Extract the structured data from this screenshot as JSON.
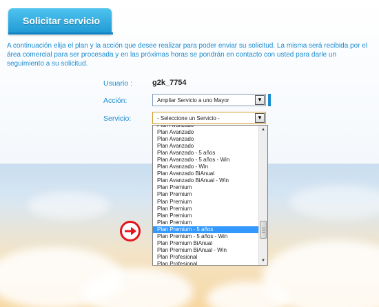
{
  "header": {
    "title": "Solicitar servicio"
  },
  "intro_text": "A continuación elija el plan y la acción que desee realizar para poder enviar su solicitud. La misma será recibida por el área comercial para ser procesada y en las próximas horas se pondrán en contacto con usted para darle un seguimiento a su solicitud.",
  "form": {
    "user_label": "Usuario :",
    "user_value": "g2k_7754",
    "action_label": "Acción:",
    "action_value": "Ampliar Servicio a uno Mayor",
    "service_label": "Servicio:",
    "service_value": "- Seleccione un Servicio -"
  },
  "service_options": [
    "Plan Avanzado",
    "Plan Avanzado",
    "Plan Avanzado",
    "Plan Avanzado",
    "Plan Avanzado - 5 años",
    "Plan Avanzado - 5 años - Win",
    "Plan Avanzado - Win",
    "Plan Avanzado BiAnual",
    "Plan Avanzado BiAnual - Win",
    "Plan Premium",
    "Plan Premium",
    "Plan Premium",
    "Plan Premium",
    "Plan Premium",
    "Plan Premium",
    "Plan Premium - 5 años",
    "Plan Premium - 5 años - Win",
    "Plan Premium BiAnual",
    "Plan Premium BiAnual - Win",
    "Plan Profesional",
    "Plan Profesional"
  ],
  "highlighted_option_index": 15,
  "colors": {
    "accent": "#1a8bd0",
    "tab": "#2aa6dd",
    "highlight": "#3399ff",
    "marker": "#e5141c"
  },
  "icons": {
    "select_arrow": "chevron-down-icon",
    "annotation": "right-arrow-circle-icon"
  }
}
